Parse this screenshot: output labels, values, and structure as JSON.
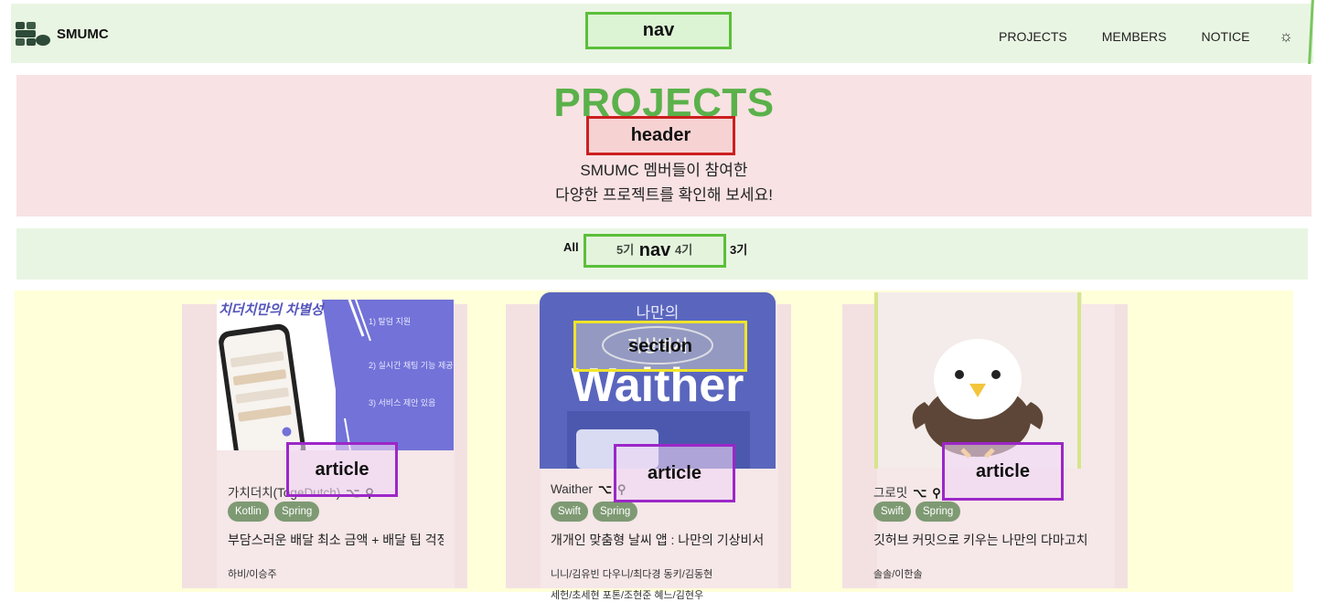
{
  "nav": {
    "brand": "SMUMC",
    "logo_text": "SMUMC",
    "links": [
      "PROJECTS",
      "MEMBERS",
      "NOTICE"
    ],
    "theme_icon": "sun-icon",
    "annotation": "nav"
  },
  "header": {
    "title": "PROJECTS",
    "subtitle_line1": "SMUMC 멤버들이 참여한",
    "subtitle_line2": "다양한 프로젝트를 확인해 보세요!",
    "annotation": "header"
  },
  "filters": {
    "items": [
      "All",
      "5기",
      "4기",
      "3기"
    ],
    "annotation": "nav"
  },
  "section": {
    "annotation": "section"
  },
  "projects": [
    {
      "name": "가치더치(TogeDutch)",
      "tags": [
        "Kotlin",
        "Spring"
      ],
      "description": "부담스러운 배달 최소 금액 + 배달 팁 걱정",
      "members": "하비/이승주",
      "thumb_caption": "치더치만의 차별성",
      "thumb_points": [
        "1) 탈덤 지원",
        "2) 실시간 채팅 기능 제공",
        "3) 서비스 제안 있음"
      ],
      "annotation": "article"
    },
    {
      "name": "Waither",
      "tags": [
        "Swift",
        "Spring"
      ],
      "description": "개개인 맞춤형 날씨 앱 : 나만의 기상비서",
      "members": "니니/김유빈  다우니/최다경  동키/김동현",
      "members_line2": "세헌/초세현  포톤/조현준  혜느/김현우",
      "thumb_caption": "나만의",
      "thumb_caption2": "기상비서",
      "thumb_brand": "Waither",
      "annotation": "article"
    },
    {
      "name": "그로밋",
      "tags": [
        "Swift",
        "Spring"
      ],
      "description": "깃허브 커밋으로 키우는 나만의 다마고치",
      "members": "솔솔/이한솔",
      "annotation": "article"
    }
  ],
  "colors": {
    "accent_green": "#5ab14a",
    "tag_bg": "#7e9a73",
    "nav_bg": "#e9f5e3",
    "header_bg": "#f8e2e4",
    "section_bg": "#ffffd9"
  }
}
